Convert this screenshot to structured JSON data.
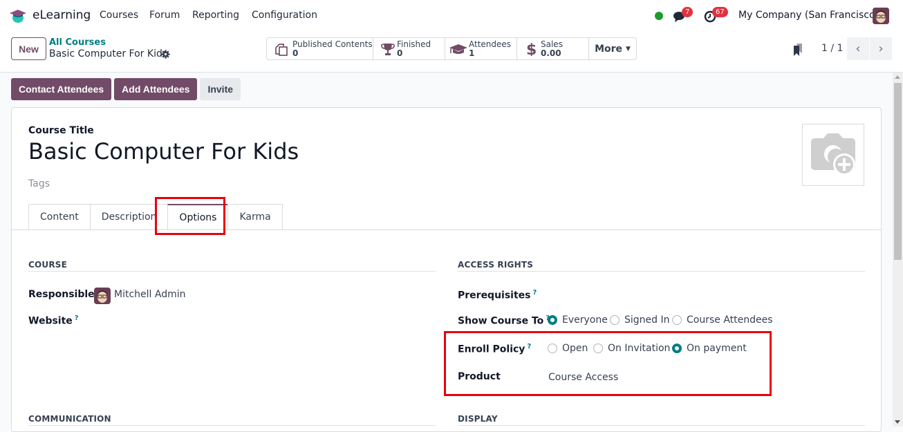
{
  "navbar": {
    "app_name": "eLearning",
    "menu": [
      "Courses",
      "Forum",
      "Reporting",
      "Configuration"
    ],
    "messages_count": "7",
    "activities_count": "67",
    "company": "My Company (San Francisco)"
  },
  "control_panel": {
    "new_label": "New",
    "breadcrumb_parent": "All Courses",
    "breadcrumb_current": "Basic Computer For Kids",
    "smart_buttons": [
      {
        "label": "Published Contents",
        "value": "0",
        "icon": "documents-icon"
      },
      {
        "label": "Finished",
        "value": "0",
        "icon": "trophy-icon"
      },
      {
        "label": "Attendees",
        "value": "1",
        "icon": "graduation-cap-icon"
      },
      {
        "label": "Sales",
        "value": "0.00",
        "icon": "dollar-icon"
      }
    ],
    "more_label": "More",
    "pager": "1 / 1"
  },
  "actions": {
    "contact_attendees": "Contact Attendees",
    "add_attendees": "Add Attendees",
    "invite": "Invite"
  },
  "form": {
    "title_label": "Course Title",
    "title": "Basic Computer For Kids",
    "tags_placeholder": "Tags",
    "tabs": [
      "Content",
      "Description",
      "Options",
      "Karma"
    ],
    "active_tab": "Options",
    "course_section": {
      "heading": "COURSE",
      "responsible_label": "Responsible",
      "responsible_value": "Mitchell Admin",
      "website_label": "Website"
    },
    "access_section": {
      "heading": "ACCESS RIGHTS",
      "prerequisites_label": "Prerequisites",
      "show_course_label": "Show Course To",
      "show_course_options": [
        "Everyone",
        "Signed In",
        "Course Attendees"
      ],
      "show_course_selected": "Everyone",
      "enroll_label": "Enroll Policy",
      "enroll_options": [
        "Open",
        "On Invitation",
        "On payment"
      ],
      "enroll_selected": "On payment",
      "product_label": "Product",
      "product_value": "Course Access"
    },
    "communication_heading": "COMMUNICATION",
    "display_heading": "DISPLAY",
    "help_mark": "?"
  },
  "colors": {
    "brand": "#714b67",
    "accent": "#017e84",
    "highlight": "#e8000b"
  }
}
